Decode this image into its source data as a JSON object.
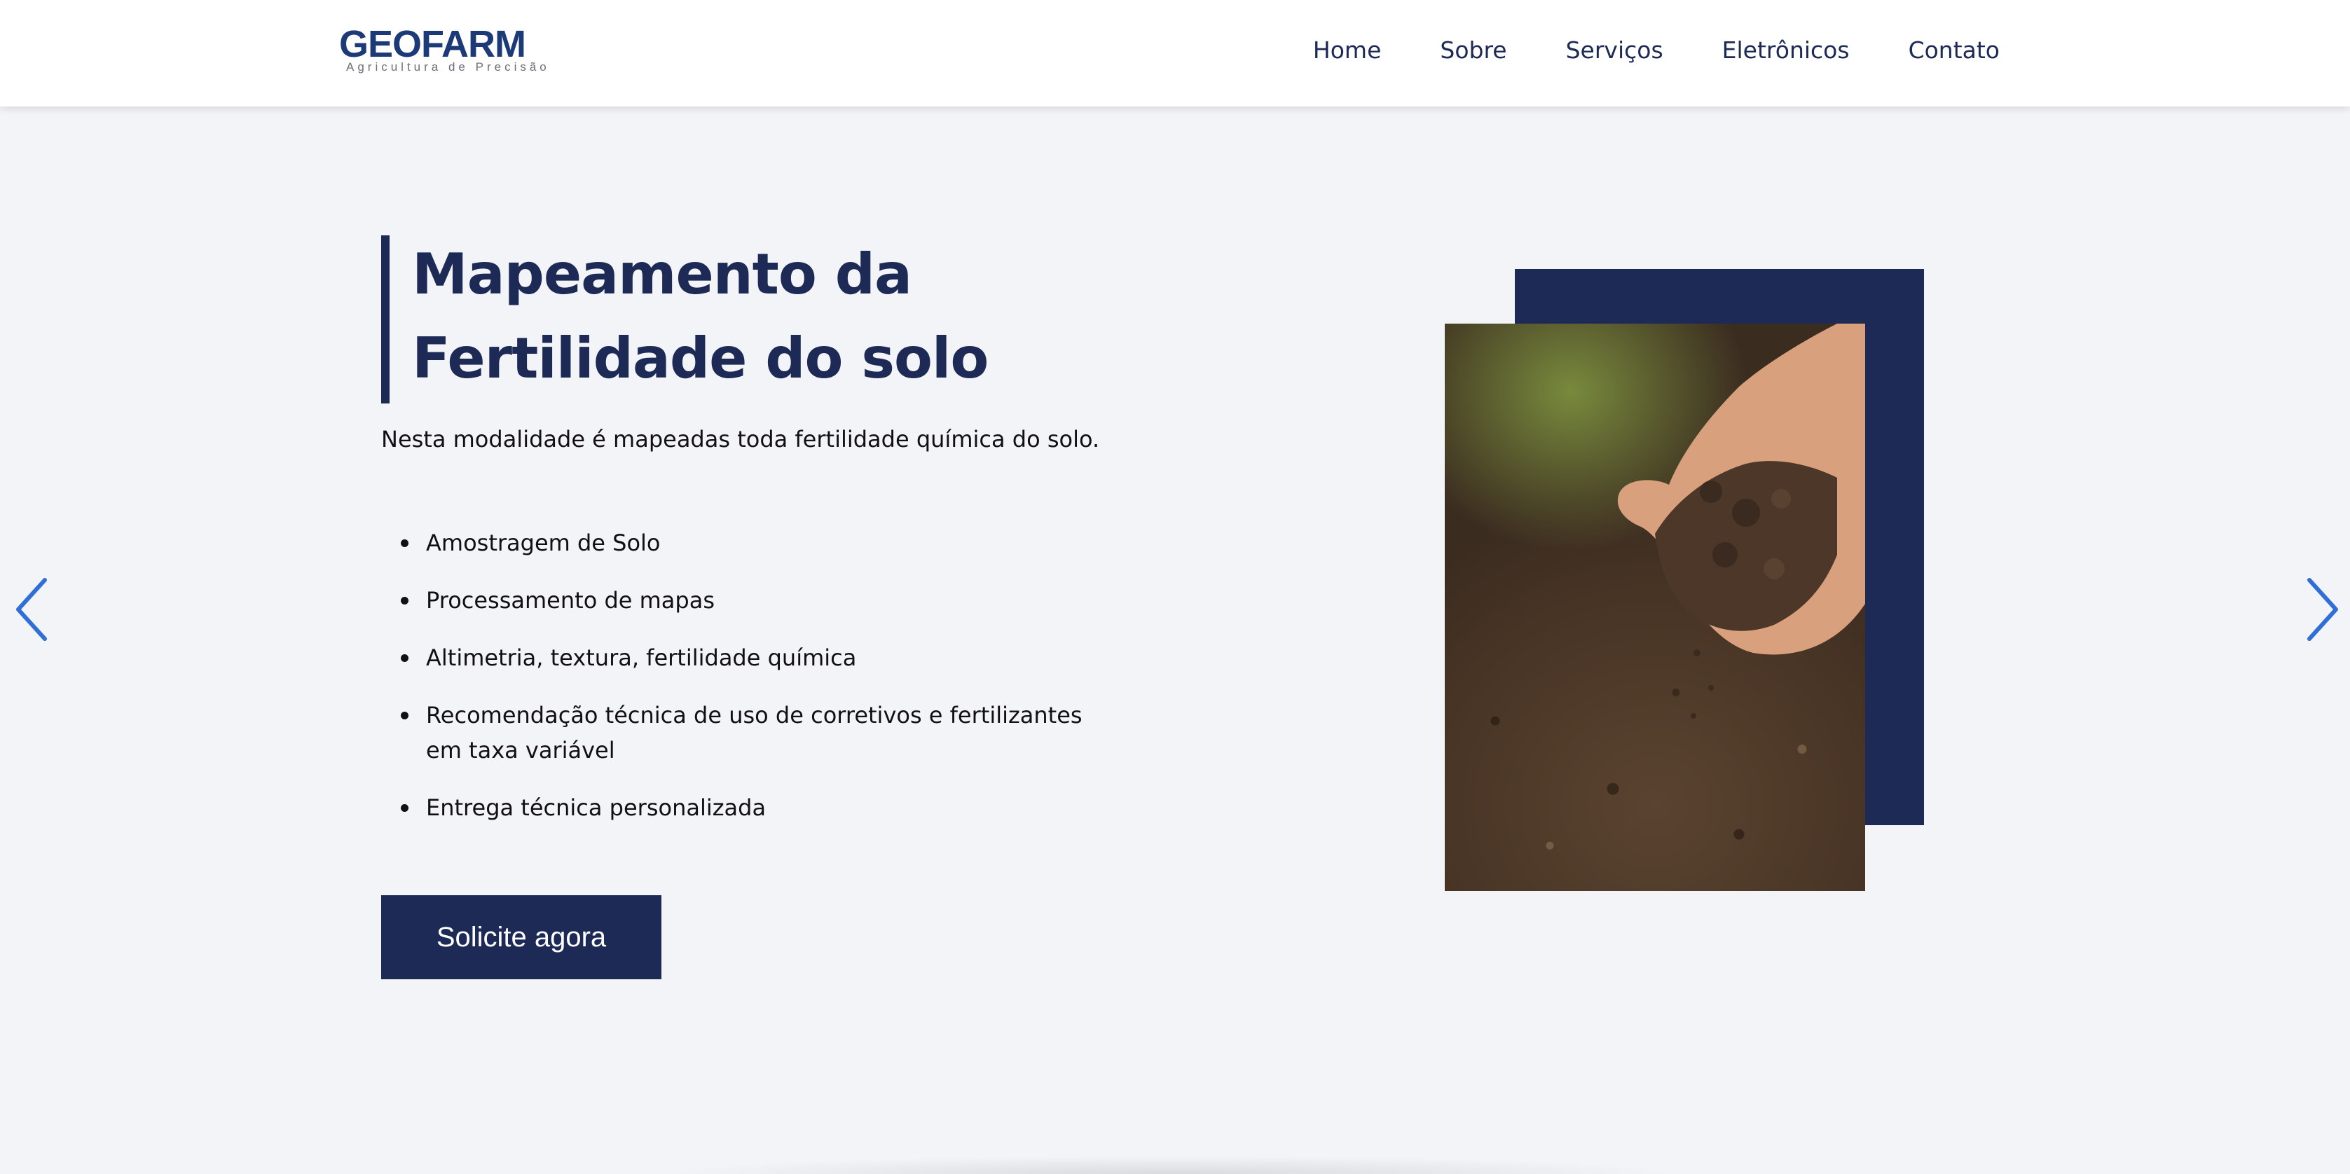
{
  "header": {
    "logo": {
      "word": "GEOFARM",
      "tagline": "Agricultura de Precisão"
    },
    "nav": [
      {
        "label": "Home"
      },
      {
        "label": "Sobre"
      },
      {
        "label": "Serviços"
      },
      {
        "label": "Eletrônicos"
      },
      {
        "label": "Contato"
      }
    ]
  },
  "hero": {
    "title": "Mapeamento da\nFertilidade do solo",
    "subtitle": "Nesta modalidade é mapeadas toda fertilidade química do solo.",
    "features": [
      "Amostragem de Solo",
      "Processamento de mapas",
      "Altimetria, textura, fertilidade química",
      "Recomendação técnica de uso de corretivos e fertilizantes em taxa variável",
      "Entrega técnica personalizada"
    ],
    "cta_label": "Solicite agora"
  },
  "carousel": {
    "prev_icon": "chevron-left-icon",
    "next_icon": "chevron-right-icon"
  },
  "colors": {
    "brand_navy": "#1c2a55",
    "accent_blue": "#2f6fd6",
    "page_bg": "#f3f4f8"
  }
}
